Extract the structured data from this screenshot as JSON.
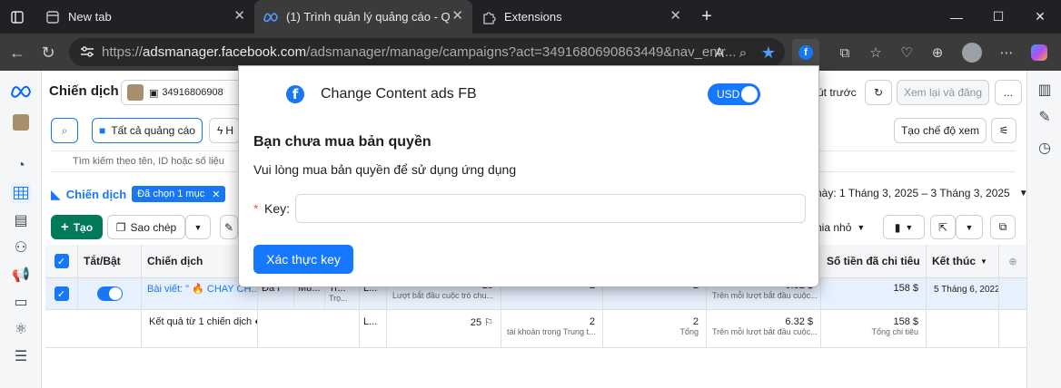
{
  "browser": {
    "tabs": [
      {
        "label": "New tab"
      },
      {
        "label": "(1) Trình quản lý quảng cáo - Quả"
      },
      {
        "label": "Extensions"
      }
    ],
    "url_prefix": "https://",
    "url_host": "adsmanager.facebook.com",
    "url_path": "/adsmanager/manage/campaigns?act=3491680690863449&nav_entr..."
  },
  "page": {
    "title": "Chiến dịch",
    "account_id": "34916806908",
    "all_ads_button": "Tất cả quảng cáo",
    "filter_partial": "H",
    "partial_discard": "út trước",
    "review_publish": "Xem lại và đăng",
    "more": "...",
    "create_view": "Tạo chế độ xem",
    "search_placeholder": "Tìm kiếm theo tên, ID hoặc số liệu",
    "tab_campaigns": "Chiến dịch",
    "selected_chip": "Đã chọn 1 mục",
    "date_range": "này: 1 Tháng 3, 2025 – 3 Tháng 3, 2025",
    "create_button": "Tạo",
    "duplicate_button": "Sao chép",
    "breakdown_partial": "hia nhỏ"
  },
  "table": {
    "headers": {
      "toggle": "Tắt/Bật",
      "campaign": "Chiến dịch",
      "spent": "Số tiền đã chi tiêu",
      "end": "Kết thúc"
    },
    "row1": {
      "campaign": "Bài viết: \" 🔥 CHAY CH...",
      "c_delivery": "Đã I",
      "c_mu": "Mu...",
      "c_tr": "Tr...",
      "c_trsub": "Trọ...",
      "c_l": "L...",
      "results": "25",
      "results_sub": "Lượt bắt đầu cuộc trò chu...",
      "reach": "2",
      "impr": "2",
      "cost": "6.32 $",
      "cost_sub": "Trên mỗi lượt bắt đầu cuộc...",
      "spent": "158 $",
      "end": "5 Tháng 6, 2022"
    },
    "row2": {
      "campaign": "Kết quả từ 1 chiến dịch ◐",
      "c_l": "L...",
      "results": "25 ⚐",
      "reach": "2",
      "reach_sub": "tài khoản trong Trung t...",
      "impr": "2",
      "impr_sub": "Tổng",
      "cost": "6.32 $",
      "cost_sub": "Trên mỗi lượt bắt đầu cuộc...",
      "spent": "158 $",
      "spent_sub": "Tổng chi tiêu"
    }
  },
  "popup": {
    "logo": "f",
    "title": "Change Content ads FB",
    "currency_switch": "USD",
    "heading": "Bạn chưa mua bản quyền",
    "message": "Vui lòng mua bản quyền để sử dụng ứng dụng",
    "required_mark": "*",
    "key_label": "Key:",
    "key_value": "",
    "verify_button": "Xác thực key"
  },
  "colors": {
    "accent": "#1677ff",
    "fb_blue": "#1877f2",
    "create_green": "#007a5a"
  }
}
